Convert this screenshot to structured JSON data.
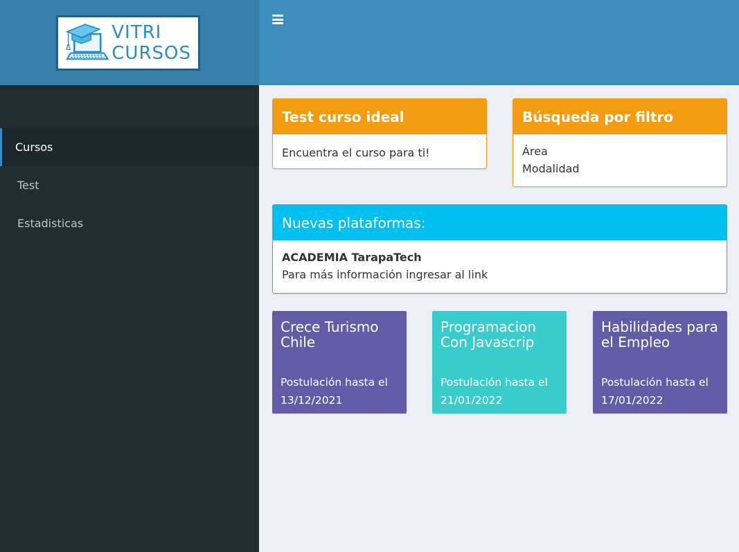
{
  "brand": {
    "line1": "VITRI",
    "line2": "CURSOS"
  },
  "sidebar": {
    "items": [
      {
        "label": "Cursos",
        "active": true
      },
      {
        "label": "Test",
        "active": false
      },
      {
        "label": "Estadisticas",
        "active": false
      }
    ]
  },
  "test_box": {
    "title": "Test curso ideal",
    "body": "Encuentra el curso para ti!"
  },
  "filter_box": {
    "title": "Búsqueda por filtro",
    "items": [
      "Área",
      "Modalidad"
    ]
  },
  "platforms_box": {
    "title": "Nuevas plataformas:",
    "name": "ACADEMIA TarapaTech",
    "info": "Para más información ingresar al link"
  },
  "courses": [
    {
      "title": "Crece Turismo Chile",
      "deadline_label": "Postulación hasta el",
      "date": "13/12/2021",
      "color": "#605ca8"
    },
    {
      "title": "Programacion Con Javascrip",
      "deadline_label": "Postulación hasta el",
      "date": "21/01/2022",
      "color": "#39cccc"
    },
    {
      "title": "Habilidades para el Empleo",
      "deadline_label": "Postulación hasta el",
      "date": "17/01/2022",
      "color": "#605ca8"
    }
  ],
  "colors": {
    "header": "#3c8dbc",
    "logo_bg": "#367fa9",
    "sidebar": "#222d32",
    "orange": "#f39c12",
    "aqua": "#00c0ef",
    "purple": "#605ca8",
    "teal": "#39cccc"
  }
}
